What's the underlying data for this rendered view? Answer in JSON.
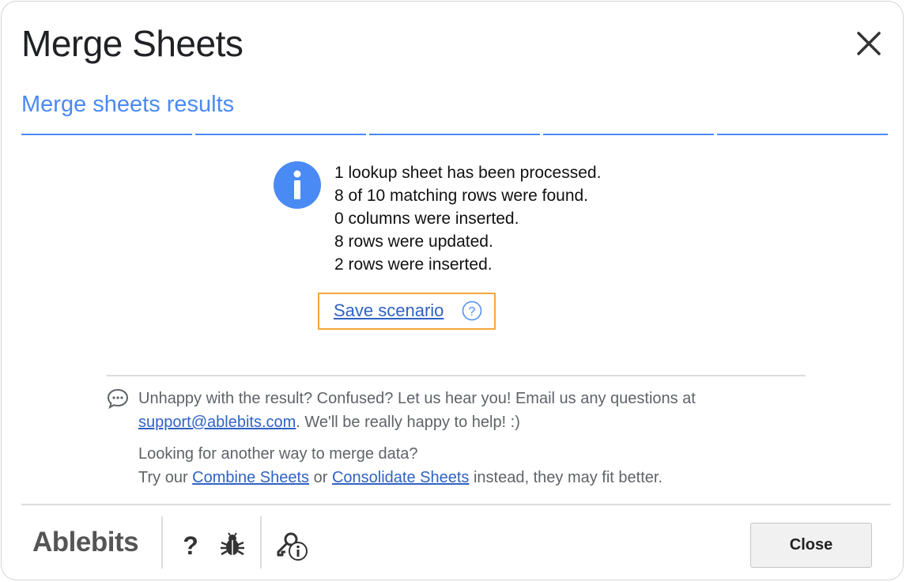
{
  "dialog": {
    "title": "Merge Sheets",
    "subtitle": "Merge sheets results"
  },
  "results": {
    "lines": [
      "1 lookup sheet has been processed.",
      "8 of 10 matching rows were found.",
      "0 columns were inserted.",
      "8 rows were updated.",
      "2 rows were inserted."
    ],
    "save_scenario_label": "Save scenario",
    "help_glyph": "?"
  },
  "feedback": {
    "text_before": "Unhappy with the result? Confused? Let us hear you! Email us any questions at",
    "email": "support@ablebits.com",
    "text_after": ". We'll be really happy to help! :)",
    "alt_line1": "Looking for another way to merge data?",
    "alt_prefix": "Try our",
    "combine_link": "Combine Sheets",
    "or_text": "or",
    "consolidate_link": "Consolidate Sheets",
    "alt_suffix": "instead, they may fit better."
  },
  "footer": {
    "brand": "Ablebits",
    "help_glyph": "?",
    "close_label": "Close"
  },
  "colors": {
    "accent": "#4a8af4",
    "link": "#2f62c4",
    "highlight_border": "#f3a73b"
  },
  "icons": [
    "close-icon",
    "info-icon",
    "help-circle-icon",
    "chat-icon",
    "help-icon",
    "bug-icon",
    "license-info-icon"
  ]
}
